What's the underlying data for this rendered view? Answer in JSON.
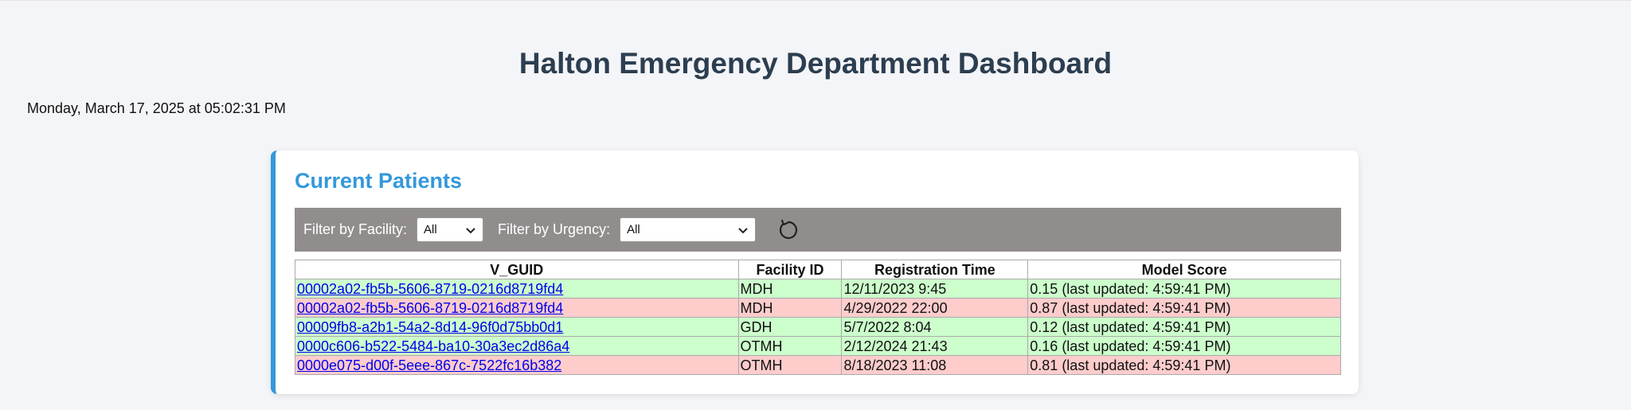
{
  "header": {
    "title": "Halton Emergency Department Dashboard",
    "datetime": "Monday, March 17, 2025 at 05:02:31 PM"
  },
  "card": {
    "title": "Current Patients"
  },
  "filters": {
    "facility_label": "Filter by Facility:",
    "facility_value": "All",
    "urgency_label": "Filter by Urgency:",
    "urgency_value": "All",
    "refresh_icon": "refresh-icon"
  },
  "table": {
    "columns": [
      "V_GUID",
      "Facility ID",
      "Registration Time",
      "Model Score"
    ],
    "rows": [
      {
        "guid": "00002a02-fb5b-5606-8719-0216d8719fd4",
        "facility": "MDH",
        "time": "12/11/2023 9:45",
        "score": "0.15 (last updated: 4:59:41 PM)",
        "status": "low"
      },
      {
        "guid": "00002a02-fb5b-5606-8719-0216d8719fd4",
        "facility": "MDH",
        "time": "4/29/2022 22:00",
        "score": "0.87 (last updated: 4:59:41 PM)",
        "status": "high"
      },
      {
        "guid": "00009fb8-a2b1-54a2-8d14-96f0d75bb0d1",
        "facility": "GDH",
        "time": "5/7/2022 8:04",
        "score": "0.12 (last updated: 4:59:41 PM)",
        "status": "low"
      },
      {
        "guid": "0000c606-b522-5484-ba10-30a3ec2d86a4",
        "facility": "OTMH",
        "time": "2/12/2024 21:43",
        "score": "0.16 (last updated: 4:59:41 PM)",
        "status": "low"
      },
      {
        "guid": "0000e075-d00f-5eee-867c-7522fc16b382",
        "facility": "OTMH",
        "time": "8/18/2023 11:08",
        "score": "0.81 (last updated: 4:59:41 PM)",
        "status": "high"
      }
    ]
  },
  "colors": {
    "title": "#2c3e50",
    "accent": "#3498db",
    "filterbar": "#928d8d",
    "low_risk": "#ccffcc",
    "high_risk": "#ffcccc"
  }
}
